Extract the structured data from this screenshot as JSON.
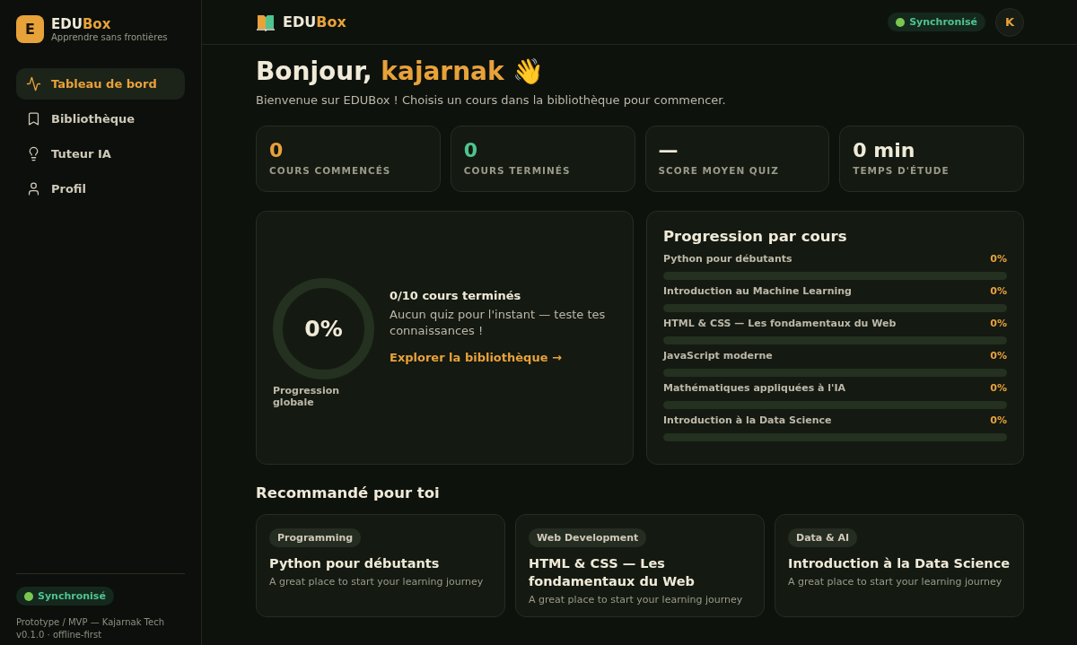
{
  "brand": {
    "initial": "E",
    "name_a": "EDU",
    "name_b": "Box",
    "tagline": "Apprendre sans frontières"
  },
  "nav": [
    {
      "label": "Tableau de bord",
      "selected": true
    },
    {
      "label": "Bibliothèque",
      "selected": false
    },
    {
      "label": "Tuteur IA",
      "selected": false
    },
    {
      "label": "Profil",
      "selected": false
    }
  ],
  "sidebar_footer": {
    "sync": "Synchronisé",
    "credit": "Prototype / MVP — Kajarnak Tech",
    "version": "v0.1.0 · offline-first"
  },
  "topbar": {
    "name_a": "EDU",
    "name_b": "Box",
    "sync": "Synchronisé",
    "avatar": "K"
  },
  "greeting": {
    "prefix": "Bonjour, ",
    "user": "kajarnak",
    "emoji": "👋",
    "subtitle": "Bienvenue sur EDUBox ! Choisis un cours dans la bibliothèque pour commencer."
  },
  "stats": [
    {
      "value": "0",
      "label": "COURS COMMENCÉS",
      "color": "#e8a23a"
    },
    {
      "value": "0",
      "label": "COURS TERMINÉS",
      "color": "#4fc48f"
    },
    {
      "value": "—",
      "label": "SCORE MOYEN QUIZ",
      "color": "#f0ead8"
    },
    {
      "value": "0 min",
      "label": "TEMPS D'ÉTUDE",
      "color": "#f0ead8"
    }
  ],
  "overall": {
    "level": 0,
    "percent": "0%",
    "caption": "Progression globale",
    "done": "0/10 cours terminés",
    "quiz": "Aucun quiz pour l'instant — teste tes connaissances !",
    "link": "Explorer la bibliothèque →"
  },
  "course_progress": {
    "title": "Progression par cours",
    "courses": [
      {
        "name": "Python pour débutants",
        "percent": "0%"
      },
      {
        "name": "Introduction au Machine Learning",
        "percent": "0%"
      },
      {
        "name": "HTML & CSS — Les fondamentaux du Web",
        "percent": "0%"
      },
      {
        "name": "JavaScript moderne",
        "percent": "0%"
      },
      {
        "name": "Mathématiques appliquées à l'IA",
        "percent": "0%"
      },
      {
        "name": "Introduction à la Data Science",
        "percent": "0%"
      }
    ]
  },
  "recommended": {
    "title": "Recommandé pour toi",
    "cards": [
      {
        "tag": "Programming",
        "title": "Python pour débutants",
        "description": "A great place to start your learning journey"
      },
      {
        "tag": "Web Development",
        "title": "HTML & CSS — Les fondamentaux du Web",
        "description": "A great place to start your learning journey"
      },
      {
        "tag": "Data & AI",
        "title": "Introduction à la Data Science",
        "description": "A great place to start your learning journey"
      }
    ]
  }
}
